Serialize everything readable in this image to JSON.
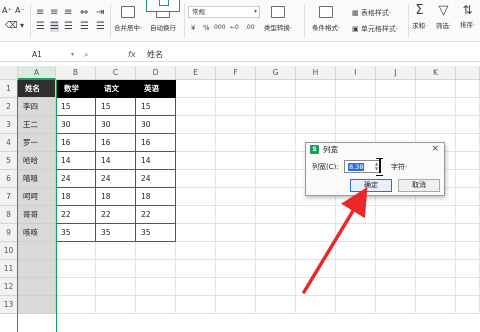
{
  "ribbon": {
    "font_size_glyphs": [
      "A⁺",
      "A⁻"
    ],
    "number_format": "常规",
    "merge_label": "合并居中·",
    "wrap_label": "自动换行",
    "percent_glyphs": [
      "¥",
      "%",
      "000",
      "←0",
      ".00"
    ],
    "convert_label": "类型转换·",
    "cond_format_label": "条件格式·",
    "table_style_label": "表格样式·",
    "cell_style_label": "单元格样式·",
    "sum_label": "求和·",
    "filter_label": "筛选·",
    "sort_label": "排序·"
  },
  "formula_bar": {
    "cell_ref": "A1",
    "content": "姓名"
  },
  "columns": [
    "A",
    "B",
    "C",
    "D",
    "E",
    "F",
    "G",
    "H",
    "I",
    "J",
    "K"
  ],
  "rows": [
    "1",
    "2",
    "3",
    "4",
    "5",
    "6",
    "7",
    "8",
    "9",
    "10",
    "11",
    "12",
    "13"
  ],
  "table": {
    "header": [
      "姓名",
      "数学",
      "语文",
      "英语"
    ],
    "body": [
      [
        "李四",
        "15",
        "15",
        "15"
      ],
      [
        "王二",
        "30",
        "30",
        "30"
      ],
      [
        "罗一",
        "16",
        "16",
        "16"
      ],
      [
        "哈哈",
        "14",
        "14",
        "14"
      ],
      [
        "嘻嘻",
        "24",
        "24",
        "24"
      ],
      [
        "呵呵",
        "18",
        "18",
        "18"
      ],
      [
        "哥哥",
        "22",
        "22",
        "22"
      ],
      [
        "咳咳",
        "35",
        "35",
        "35"
      ]
    ]
  },
  "dialog": {
    "title": "列宽",
    "label": "列宽(C):",
    "value": "8.38",
    "unit": "字符·",
    "ok": "确定",
    "cancel": "取消",
    "close": "×",
    "spin_up": "▲",
    "spin_down": "▼"
  },
  "colors": {
    "selection_green": "#1a9c5b",
    "arrow_red": "#e8282b",
    "header_black": "#000000",
    "focus_blue": "#2f6fd8"
  }
}
